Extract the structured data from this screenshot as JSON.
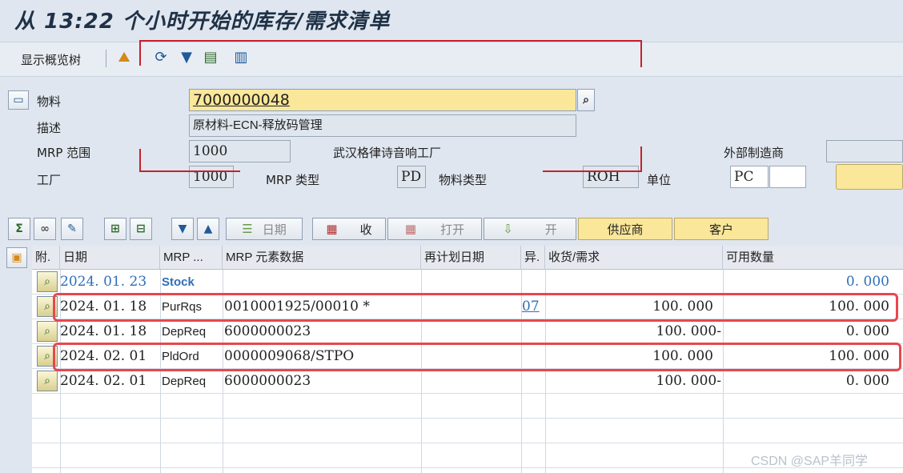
{
  "title": "从 13:22 个小时开始的库存/需求清单",
  "toolbar": {
    "show_tree": "显示概览树"
  },
  "header": {
    "material_label": "物料",
    "material_value": "7000000048",
    "description_label": "描述",
    "description_value": "原材料-ECN-释放码管理",
    "mrp_area_label": "MRP 范围",
    "mrp_area_value": "1000",
    "mrp_area_text": "武汉格律诗音响工厂",
    "external_mfr_label": "外部制造商",
    "plant_label": "工厂",
    "plant_value": "1000",
    "mrp_type_label": "MRP 类型",
    "mrp_type_value": "PD",
    "material_type_label": "物料类型",
    "material_type_value": "ROH",
    "unit_label": "单位",
    "unit_value": "PC"
  },
  "buttons": {
    "date": "日期",
    "receipt": "收",
    "open": "打开",
    "open2": "开",
    "supplier": "供应商",
    "customer": "客户"
  },
  "columns": [
    "附.",
    "日期",
    "MRP ...",
    "MRP 元素数据",
    "再计划日期",
    "异.",
    "收货/需求",
    "可用数量"
  ],
  "rows": [
    {
      "date": "2024. 01. 23",
      "mrp": "Stock",
      "data": "",
      "resched": "",
      "exc": "",
      "qty": "",
      "avail": "0. 000",
      "blue": true
    },
    {
      "date": "2024. 01. 18",
      "mrp": "PurRqs",
      "data": "0010001925/00010 *",
      "resched": "",
      "exc": "07",
      "qty": "100. 000",
      "avail": "100. 000",
      "blue": false
    },
    {
      "date": "2024. 01. 18",
      "mrp": "DepReq",
      "data": "6000000023",
      "resched": "",
      "exc": "",
      "qty": "100. 000-",
      "avail": "0. 000",
      "blue": false
    },
    {
      "date": "2024. 02. 01",
      "mrp": "PldOrd",
      "data": "0000009068/STPO",
      "resched": "",
      "exc": "",
      "qty": "100. 000",
      "avail": "100. 000",
      "blue": false
    },
    {
      "date": "2024. 02. 01",
      "mrp": "DepReq",
      "data": "6000000023",
      "resched": "",
      "exc": "",
      "qty": "100. 000-",
      "avail": "0. 000",
      "blue": false
    }
  ],
  "watermark": "CSDN @SAP羊同学",
  "colors": {
    "highlight": "#e8474f",
    "link": "#2f6fb8",
    "input_yellow": "#fbe79a"
  }
}
